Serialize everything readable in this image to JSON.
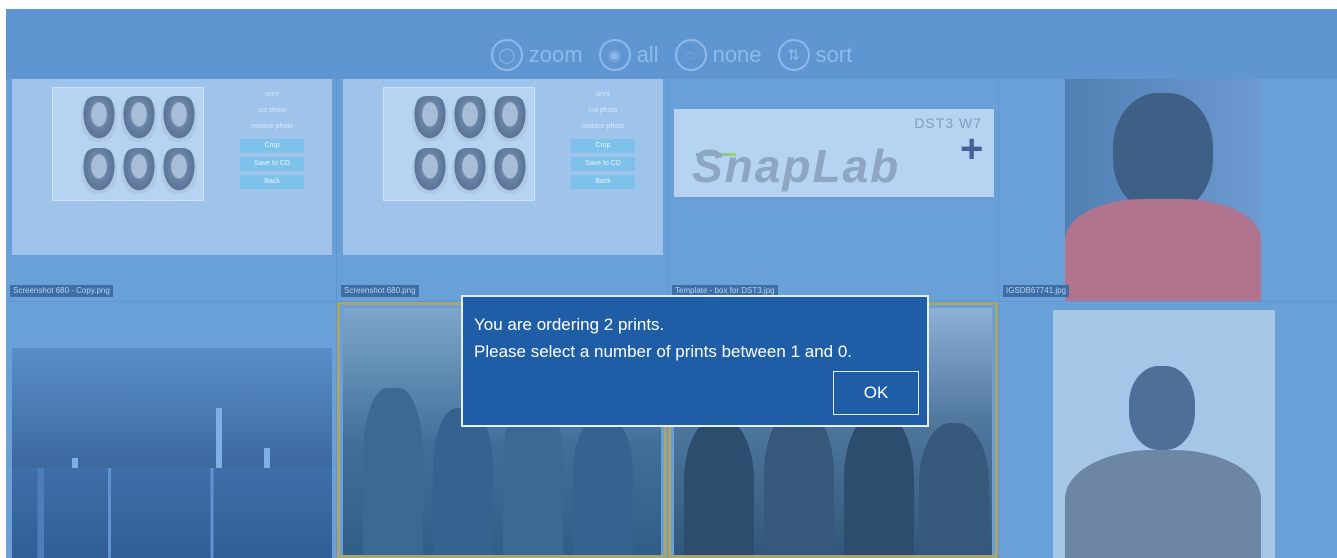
{
  "toolbar": {
    "items": [
      {
        "label": "zoom",
        "icon": "zoom-icon",
        "glyph": "◯"
      },
      {
        "label": "all",
        "icon": "select-all-icon",
        "glyph": "◉"
      },
      {
        "label": "none",
        "icon": "select-none-icon",
        "glyph": "◌"
      },
      {
        "label": "sort",
        "icon": "sort-icon",
        "glyph": "⇅"
      }
    ]
  },
  "tiles": {
    "t1": {
      "caption": "Screenshot 680 - Copy.png",
      "menu": [
        "print",
        "cut photo",
        "replace photo"
      ],
      "buttons": [
        "Crop",
        "Save to CD",
        "Back"
      ]
    },
    "t2": {
      "caption": "Screenshot 680.png",
      "menu": [
        "print",
        "cut photo",
        "replace photo"
      ],
      "buttons": [
        "Crop",
        "Save to CD",
        "Back"
      ]
    },
    "t3": {
      "caption": "Template - box for DST3.jpg",
      "logo_top": "DST3 W7",
      "logo_main": "SnapLab",
      "logo_plus": "+"
    },
    "t4": {
      "caption": "IGSDB67741.jpg"
    }
  },
  "dialog": {
    "line1": "You are ordering 2 prints.",
    "line2": "Please select a number of prints between 1 and 0.",
    "ok_label": "OK"
  },
  "colors": {
    "background": "#5f96d2",
    "dialog": "#1f5ea7",
    "accent_button": "#7dc2ea"
  }
}
